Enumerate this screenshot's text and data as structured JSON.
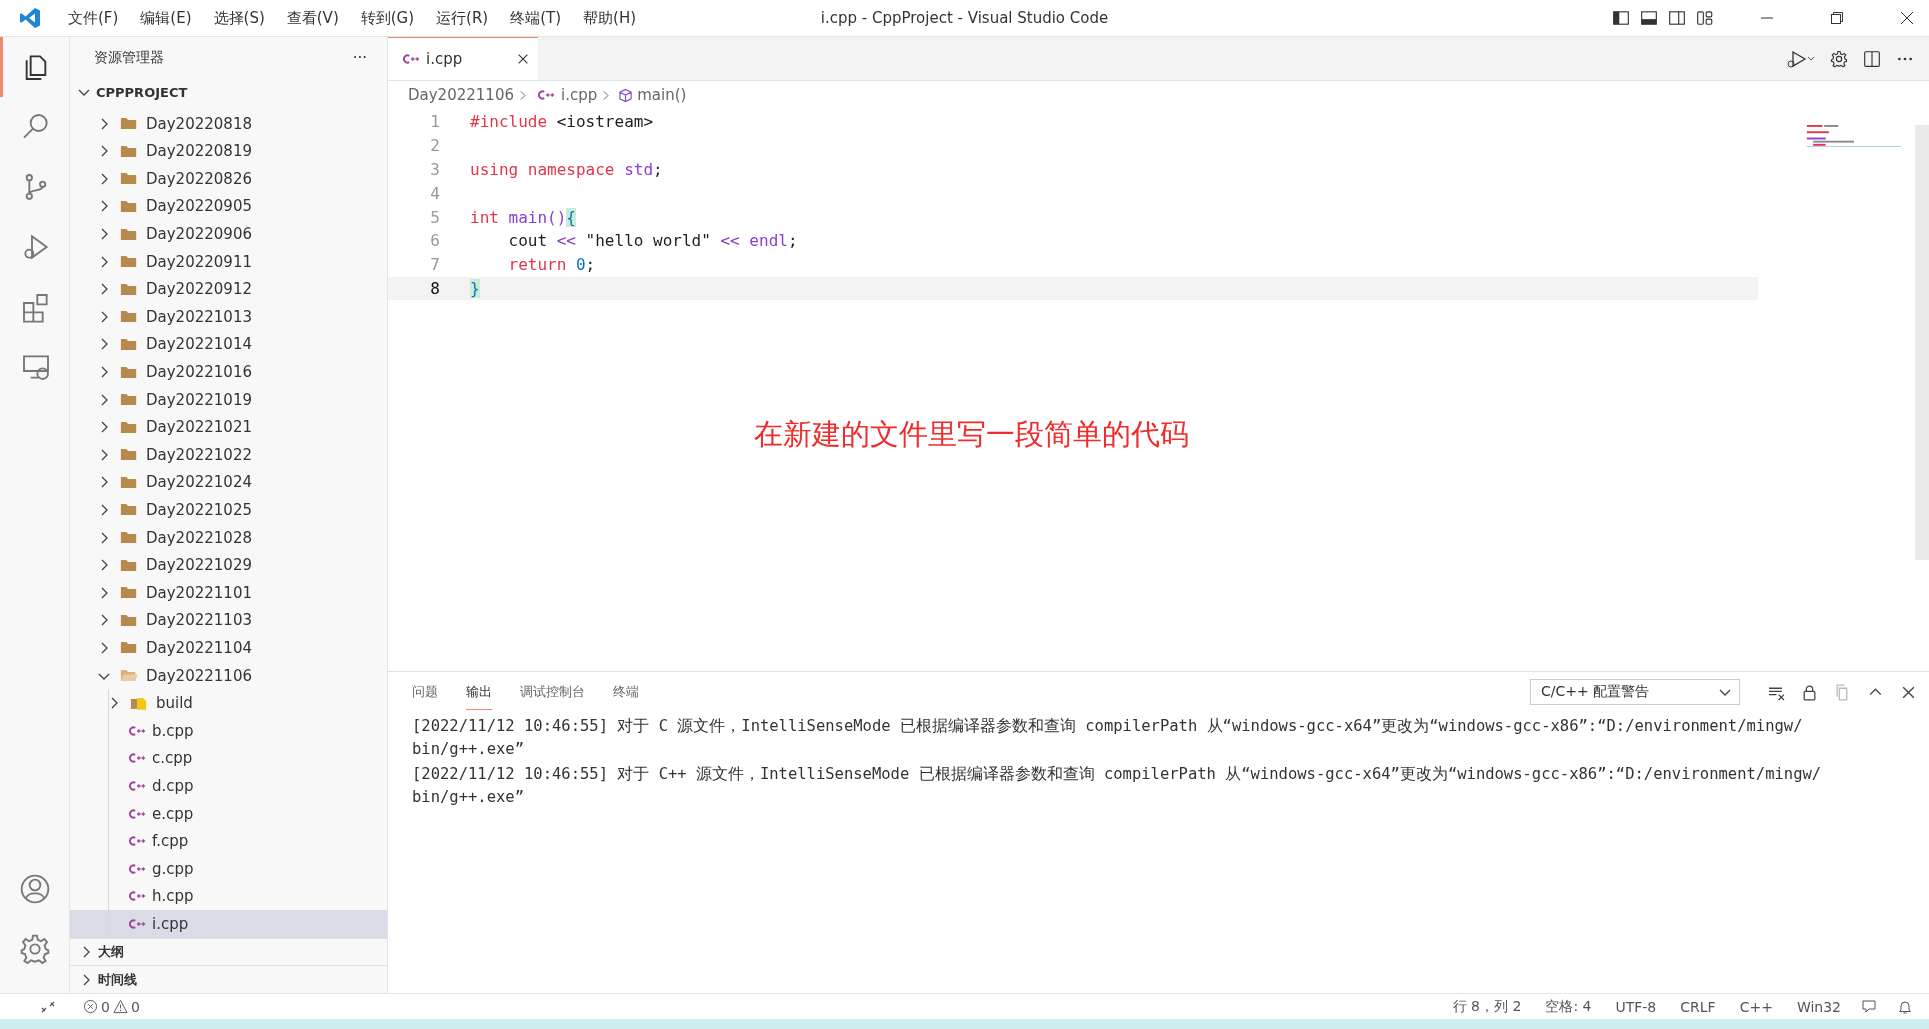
{
  "window": {
    "title": "i.cpp - CppProject - Visual Studio Code"
  },
  "menu": [
    "文件(F)",
    "编辑(E)",
    "选择(S)",
    "查看(V)",
    "转到(G)",
    "运行(R)",
    "终端(T)",
    "帮助(H)"
  ],
  "activity_bar": [
    {
      "kind": "explorer",
      "selected": true
    },
    {
      "kind": "search",
      "selected": false
    },
    {
      "kind": "source-control",
      "selected": false
    },
    {
      "kind": "run-debug",
      "selected": false
    },
    {
      "kind": "extensions",
      "selected": false
    },
    {
      "kind": "remote",
      "selected": false
    }
  ],
  "sidebar": {
    "title": "资源管理器",
    "more": "···",
    "project": "CPPPROJECT",
    "tree": [
      {
        "label": "Day20220818",
        "kind": "folder",
        "expanded": false,
        "selected": false
      },
      {
        "label": "Day20220819",
        "kind": "folder",
        "expanded": false,
        "selected": false
      },
      {
        "label": "Day20220826",
        "kind": "folder",
        "expanded": false,
        "selected": false
      },
      {
        "label": "Day20220905",
        "kind": "folder",
        "expanded": false,
        "selected": false
      },
      {
        "label": "Day20220906",
        "kind": "folder",
        "expanded": false,
        "selected": false
      },
      {
        "label": "Day20220911",
        "kind": "folder",
        "expanded": false,
        "selected": false
      },
      {
        "label": "Day20220912",
        "kind": "folder",
        "expanded": false,
        "selected": false
      },
      {
        "label": "Day20221013",
        "kind": "folder",
        "expanded": false,
        "selected": false
      },
      {
        "label": "Day20221014",
        "kind": "folder",
        "expanded": false,
        "selected": false
      },
      {
        "label": "Day20221016",
        "kind": "folder",
        "expanded": false,
        "selected": false
      },
      {
        "label": "Day20221019",
        "kind": "folder",
        "expanded": false,
        "selected": false
      },
      {
        "label": "Day20221021",
        "kind": "folder",
        "expanded": false,
        "selected": false
      },
      {
        "label": "Day20221022",
        "kind": "folder",
        "expanded": false,
        "selected": false
      },
      {
        "label": "Day20221024",
        "kind": "folder",
        "expanded": false,
        "selected": false
      },
      {
        "label": "Day20221025",
        "kind": "folder",
        "expanded": false,
        "selected": false
      },
      {
        "label": "Day20221028",
        "kind": "folder",
        "expanded": false,
        "selected": false
      },
      {
        "label": "Day20221029",
        "kind": "folder",
        "expanded": false,
        "selected": false
      },
      {
        "label": "Day20221101",
        "kind": "folder",
        "expanded": false,
        "selected": false
      },
      {
        "label": "Day20221103",
        "kind": "folder",
        "expanded": false,
        "selected": false
      },
      {
        "label": "Day20221104",
        "kind": "folder",
        "expanded": false,
        "selected": false
      },
      {
        "label": "Day20221106",
        "kind": "folder",
        "expanded": true,
        "selected": false,
        "children": [
          {
            "label": "build",
            "kind": "build-folder",
            "expanded": false,
            "selected": false
          },
          {
            "label": "b.cpp",
            "kind": "cpp",
            "selected": false
          },
          {
            "label": "c.cpp",
            "kind": "cpp",
            "selected": false
          },
          {
            "label": "d.cpp",
            "kind": "cpp",
            "selected": false
          },
          {
            "label": "e.cpp",
            "kind": "cpp",
            "selected": false
          },
          {
            "label": "f.cpp",
            "kind": "cpp",
            "selected": false
          },
          {
            "label": "g.cpp",
            "kind": "cpp",
            "selected": false
          },
          {
            "label": "h.cpp",
            "kind": "cpp",
            "selected": false
          },
          {
            "label": "i.cpp",
            "kind": "cpp",
            "selected": true
          }
        ]
      }
    ],
    "sections": [
      {
        "label": "大纲",
        "expanded": false
      },
      {
        "label": "时间线",
        "expanded": false
      }
    ]
  },
  "tabs": [
    {
      "label": "i.cpp",
      "selected": true
    }
  ],
  "breadcrumb": [
    {
      "label": "Day20221106"
    },
    {
      "label": "i.cpp",
      "kind": "cpp"
    },
    {
      "label": "main()",
      "kind": "symbol"
    }
  ],
  "code_lines": [
    {
      "number": "1",
      "current": false,
      "tokens": [
        {
          "text": "#include",
          "kind": "keyword"
        },
        {
          "text": " <iostream>",
          "kind": "plain"
        }
      ]
    },
    {
      "number": "2",
      "current": false
    },
    {
      "number": "3",
      "current": false,
      "tokens": [
        {
          "text": "using namespace ",
          "kind": "keyword"
        },
        {
          "text": "std",
          "kind": "ident"
        },
        {
          "text": ";",
          "kind": "plain"
        }
      ]
    },
    {
      "number": "4",
      "current": false
    },
    {
      "number": "5",
      "current": false,
      "tokens": [
        {
          "text": "int ",
          "kind": "keyword"
        },
        {
          "text": "main()",
          "kind": "ident"
        },
        {
          "text": "{",
          "kind": "brace-match"
        }
      ]
    },
    {
      "number": "6",
      "current": false,
      "tokens": [
        {
          "text": "    cout ",
          "kind": "plain"
        },
        {
          "text": "<<",
          "kind": "ident"
        },
        {
          "text": " \"hello world\" ",
          "kind": "plain"
        },
        {
          "text": "<< endl",
          "kind": "ident"
        },
        {
          "text": ";",
          "kind": "plain"
        }
      ]
    },
    {
      "number": "7",
      "current": false,
      "tokens": [
        {
          "text": "    return ",
          "kind": "keyword"
        },
        {
          "text": "0",
          "kind": "number"
        },
        {
          "text": ";",
          "kind": "plain"
        }
      ]
    },
    {
      "number": "8",
      "current": true,
      "tokens": [
        {
          "text": "}",
          "kind": "brace-match"
        }
      ]
    }
  ],
  "annotation": "在新建的文件里写一段简单的代码",
  "panel": {
    "tabs": [
      {
        "label": "问题",
        "selected": false
      },
      {
        "label": "输出",
        "selected": true
      },
      {
        "label": "调试控制台",
        "selected": false
      },
      {
        "label": "终端",
        "selected": false
      }
    ],
    "channel": "C/C++ 配置警告",
    "output_lines": [
      "[2022/11/12 10:46:55] 对于 C 源文件，IntelliSenseMode 已根据编译器参数和查询 compilerPath 从“windows-gcc-x64”更改为“windows-gcc-x86”:“D:/environment/mingw/",
      "bin/g++.exe”",
      "[2022/11/12 10:46:55] 对于 C++ 源文件，IntelliSenseMode 已根据编译器参数和查询 compilerPath 从“windows-gcc-x64”更改为“windows-gcc-x86”:“D:/environment/mingw/",
      "bin/g++.exe”"
    ]
  },
  "status_bar": {
    "errors": "0",
    "warnings": "0",
    "right": [
      "行 8，列 2",
      "空格: 4",
      "UTF-8",
      "CRLF",
      "C++",
      "Win32"
    ]
  }
}
